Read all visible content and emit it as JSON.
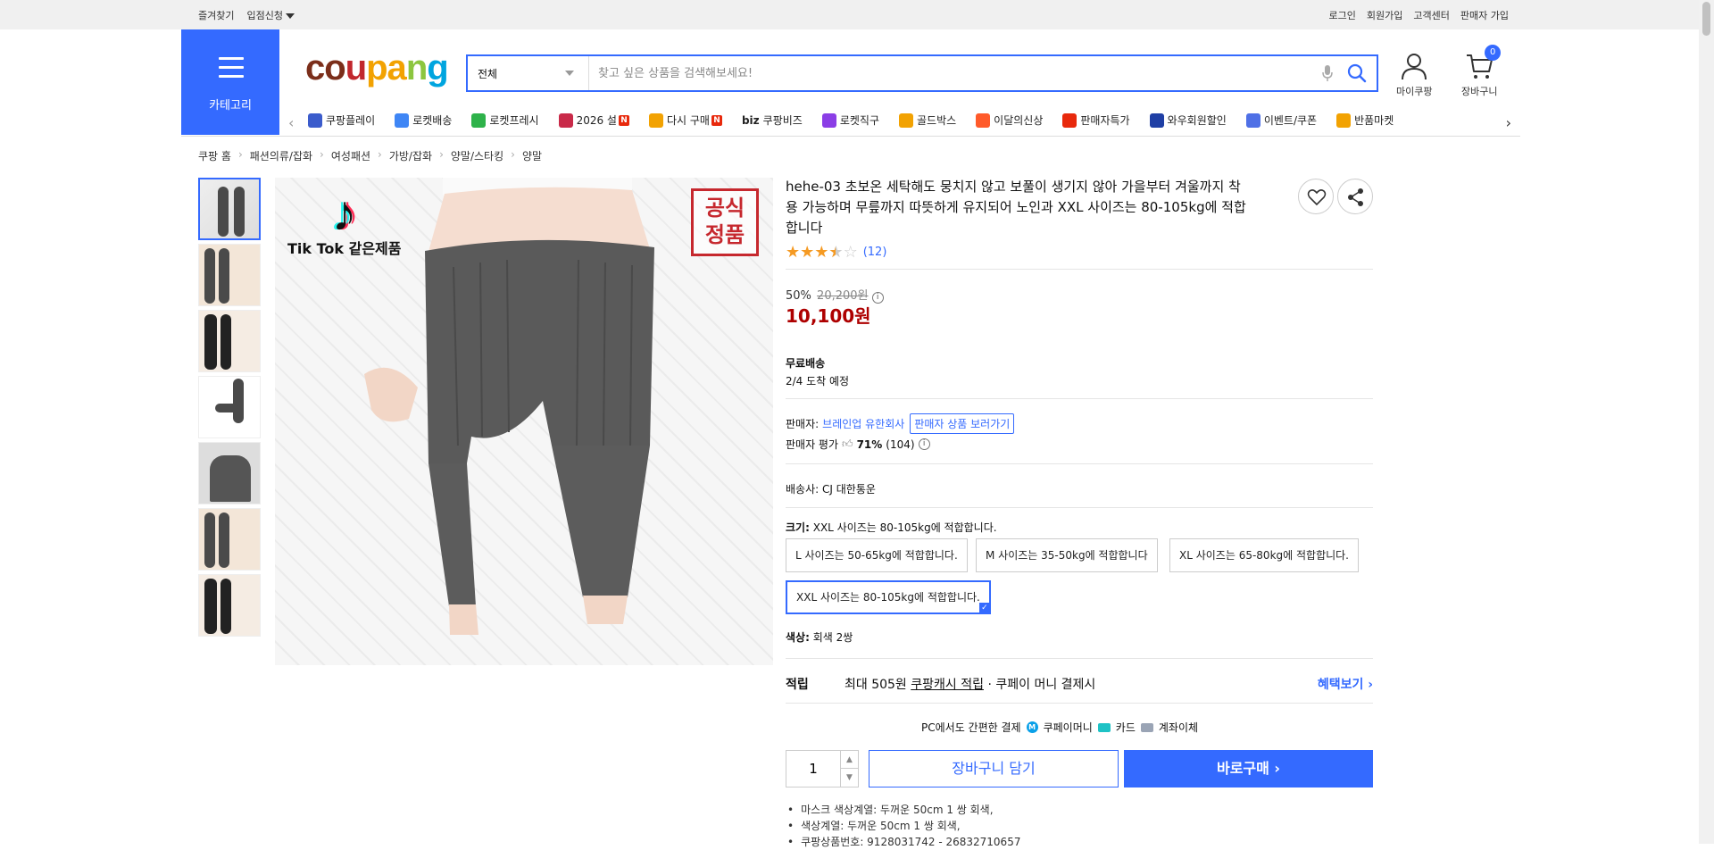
{
  "topbar": {
    "favorites": "즐겨찾기",
    "vendor_apply": "입점신청",
    "login": "로그인",
    "signup": "회원가입",
    "customer_center": "고객센터",
    "seller_signup": "판매자 가입"
  },
  "header": {
    "category_label": "카테고리",
    "logo": {
      "p1": "co",
      "p2": "u",
      "p3": "pa",
      "p4": "n",
      "p5": "g"
    },
    "search_category": "전체",
    "search_placeholder": "찾고 싶은 상품을 검색해보세요!",
    "mypage": "마이쿠팡",
    "cart": "장바구니",
    "cart_count": "0"
  },
  "nav": {
    "items": [
      {
        "label": "쿠팡플레이",
        "color": "#3b5ccc"
      },
      {
        "label": "로켓배송",
        "color": "#3f86f5"
      },
      {
        "label": "로켓프레시",
        "color": "#2eb24a"
      },
      {
        "label": "2026 설",
        "color": "#c92a49",
        "badge": "N"
      },
      {
        "label": "다시 구매",
        "color": "#f2a202",
        "badge": "N"
      },
      {
        "label": "쿠팡비즈",
        "prefix": "biz",
        "color": "#333333"
      },
      {
        "label": "로켓직구",
        "color": "#8b3ee6"
      },
      {
        "label": "골드박스",
        "color": "#f2a202"
      },
      {
        "label": "이달의신상",
        "color": "#ff5a2a"
      },
      {
        "label": "판매자특가",
        "color": "#e8290c"
      },
      {
        "label": "와우회원할인",
        "color": "#1f3fa5"
      },
      {
        "label": "이벤트/쿠폰",
        "color": "#4f70e6"
      },
      {
        "label": "반품마켓",
        "color": "#f2a202"
      }
    ]
  },
  "breadcrumb": [
    "쿠팡 홈",
    "패션의류/잡화",
    "여성패션",
    "가방/잡화",
    "양말/스타킹",
    "양말"
  ],
  "product": {
    "image_caption": "Tik Tok 같은제품",
    "stamp": "공식\n정품",
    "title": "hehe-03 초보온 세탁해도 뭉치지 않고 보풀이 생기지 않아 가을부터 겨울까지 착용 가능하며 무릎까지 따뜻하게 유지되어 노인과 XXL 사이즈는 80-105kg에 적합합니다",
    "rating": 3.5,
    "review_count": "(12)",
    "discount": "50%",
    "original_price": "20,200원",
    "price": "10,100원",
    "shipping_type": "무료배송",
    "arrival": "2/4 도착 예정",
    "seller_label": "판매자:",
    "seller_name": "브레인업 유한회사",
    "seller_shop_button": "판매자 상품 보러가기",
    "seller_rating_label": "판매자 평가",
    "seller_rating": "71%",
    "seller_rating_count": "(104)",
    "carrier_label": "배송사:",
    "carrier": "CJ 대한통운",
    "size_label": "크기:",
    "size_selected": "XXL 사이즈는 80-105kg에 적합합니다.",
    "size_options": [
      "L 사이즈는 50-65kg에 적합합니다.",
      "M 사이즈는 35-50kg에 적합합니다",
      "XL 사이즈는 65-80kg에 적합합니다.",
      "XXL 사이즈는 80-105kg에 적합합니다."
    ],
    "color_label": "색상:",
    "color_value": "회색 2쌍",
    "reward_label": "적립",
    "reward_text_a": "최대 505원 ",
    "reward_text_link": "쿠팡캐시 적립",
    "reward_text_b": " · 쿠페이 머니 결제시",
    "reward_more": "혜택보기 ›",
    "pay_title": "PC에서도 간편한 결제",
    "pay_methods": [
      "쿠페이머니",
      "카드",
      "계좌이체"
    ],
    "quantity": "1",
    "add_to_cart": "장바구니 담기",
    "buy_now": "바로구매 ›",
    "details": [
      "마스크 색상계열: 두꺼운 50cm 1 쌍 회색,",
      "색상계열: 두꺼운 50cm 1 쌍 회색,",
      "쿠팡상품번호: 9128031742 - 26832710657"
    ]
  }
}
